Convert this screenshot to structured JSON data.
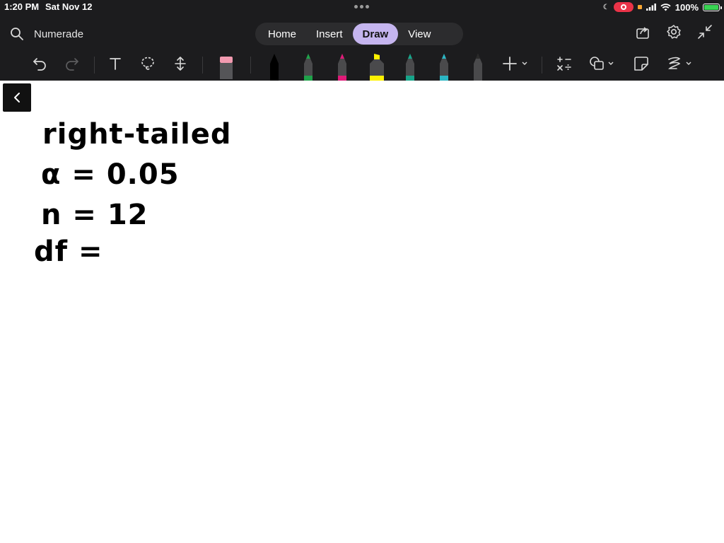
{
  "status_bar": {
    "time": "1:20 PM",
    "date": "Sat Nov 12",
    "battery": "100%",
    "battery_level": 1.0
  },
  "search": {
    "label": "Numerade"
  },
  "tabs": [
    {
      "label": "Home",
      "active": false
    },
    {
      "label": "Insert",
      "active": false
    },
    {
      "label": "Draw",
      "active": true
    },
    {
      "label": "View",
      "active": false
    }
  ],
  "toolbar": {
    "icons": [
      "undo-icon",
      "redo-icon",
      "text-icon",
      "lasso-icon",
      "space-icon",
      "eraser-icon",
      "add-icon",
      "math-icon",
      "shapes-icon",
      "ink-to-shape-icon",
      "ink-replay-icon"
    ],
    "pens": [
      {
        "color": "#000000",
        "selected": true
      },
      {
        "color": "#1fa24a",
        "selected": false
      },
      {
        "color": "#e01a78",
        "selected": false
      },
      {
        "color": "#fff200",
        "selected": false,
        "highlighter": true
      },
      {
        "color": "#17a58a",
        "selected": false
      },
      {
        "color": "#2bb6c4",
        "selected": false
      },
      {
        "color": "#3a3a3a",
        "selected": false
      }
    ]
  },
  "accent_color": "#c5b5ef",
  "canvas": {
    "lines": [
      "right-tailed",
      "α = 0.05",
      "n = 12",
      "df ="
    ]
  }
}
